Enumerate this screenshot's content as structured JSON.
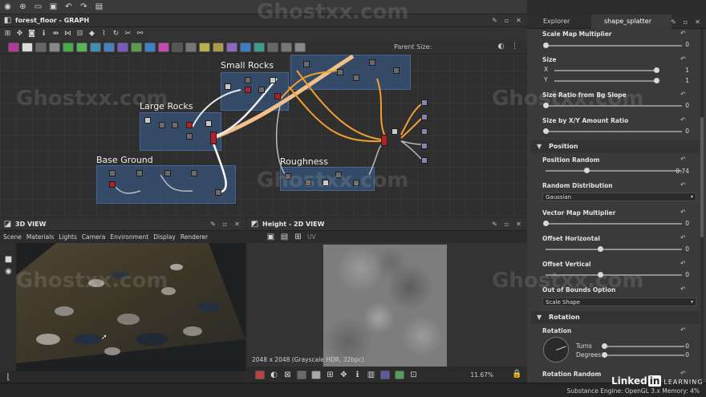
{
  "graph_window": {
    "title": "forest_floor - GRAPH",
    "parent_size_label": "Parent Size:",
    "frames": [
      {
        "label": "Small Rocks"
      },
      {
        "label": "Large Rocks"
      },
      {
        "label": "Base Ground"
      },
      {
        "label": "Roughness"
      }
    ],
    "toolbar_icons": [
      "frame-icon",
      "move-icon",
      "camera-icon",
      "info-icon",
      "distance-icon",
      "hierarchy-icon",
      "python-icon",
      "links-icon",
      "refresh-icon",
      "tools-icon",
      "link-icon"
    ]
  },
  "view3d": {
    "title": "3D VIEW",
    "menu": [
      "Scene",
      "Materials",
      "Lights",
      "Camera",
      "Environment",
      "Display",
      "Renderer"
    ]
  },
  "view2d": {
    "title": "Height - 2D VIEW",
    "uv_label": "UV",
    "resolution": "2048 x 2048 (Grayscale HDR, 32bpc)",
    "zoom": "11.67%"
  },
  "right_panel": {
    "tabs": [
      "Explorer",
      "shape_splatter"
    ],
    "props": {
      "scale_map_multiplier": {
        "label": "Scale Map Multiplier",
        "value": "0"
      },
      "size": {
        "label": "Size",
        "x_label": "X",
        "y_label": "Y",
        "x": "1",
        "y": "1"
      },
      "size_ratio": {
        "label": "Size Ratio from Bg Slope",
        "value": "0"
      },
      "size_xy": {
        "label": "Size by X/Y Amount Ratio",
        "value": "0"
      },
      "position_section": "Position",
      "position_random": {
        "label": "Position Random",
        "value": "0.74"
      },
      "random_distribution": {
        "label": "Random Distribution",
        "value": "Gaussian"
      },
      "vector_map_multiplier": {
        "label": "Vector Map Multiplier",
        "value": "0"
      },
      "offset_horizontal": {
        "label": "Offset Horizontal",
        "value": "0"
      },
      "offset_vertical": {
        "label": "Offset Vertical",
        "value": "0"
      },
      "out_of_bounds": {
        "label": "Out of Bounds Option",
        "value": "Scale Shape"
      },
      "rotation_section": "Rotation",
      "rotation": {
        "label": "Rotation",
        "turns_label": "Turns",
        "degrees_label": "Degrees",
        "turns": "0",
        "degrees": "0"
      },
      "rotation_random": {
        "label": "Rotation Random"
      }
    }
  },
  "status": {
    "engine": "Substance Engine: OpenGL 3.x  Memory: 4%"
  },
  "branding": {
    "linkedin": "Linked",
    "in": "in",
    "learning": "LEARNING",
    "watermark": "Ghostxx.com"
  },
  "colors": {
    "frame_blue": "#3a6096",
    "wire_orange": "#f0a030",
    "wire_peach": "#f2c08a",
    "node_red": "#b21e2a"
  }
}
